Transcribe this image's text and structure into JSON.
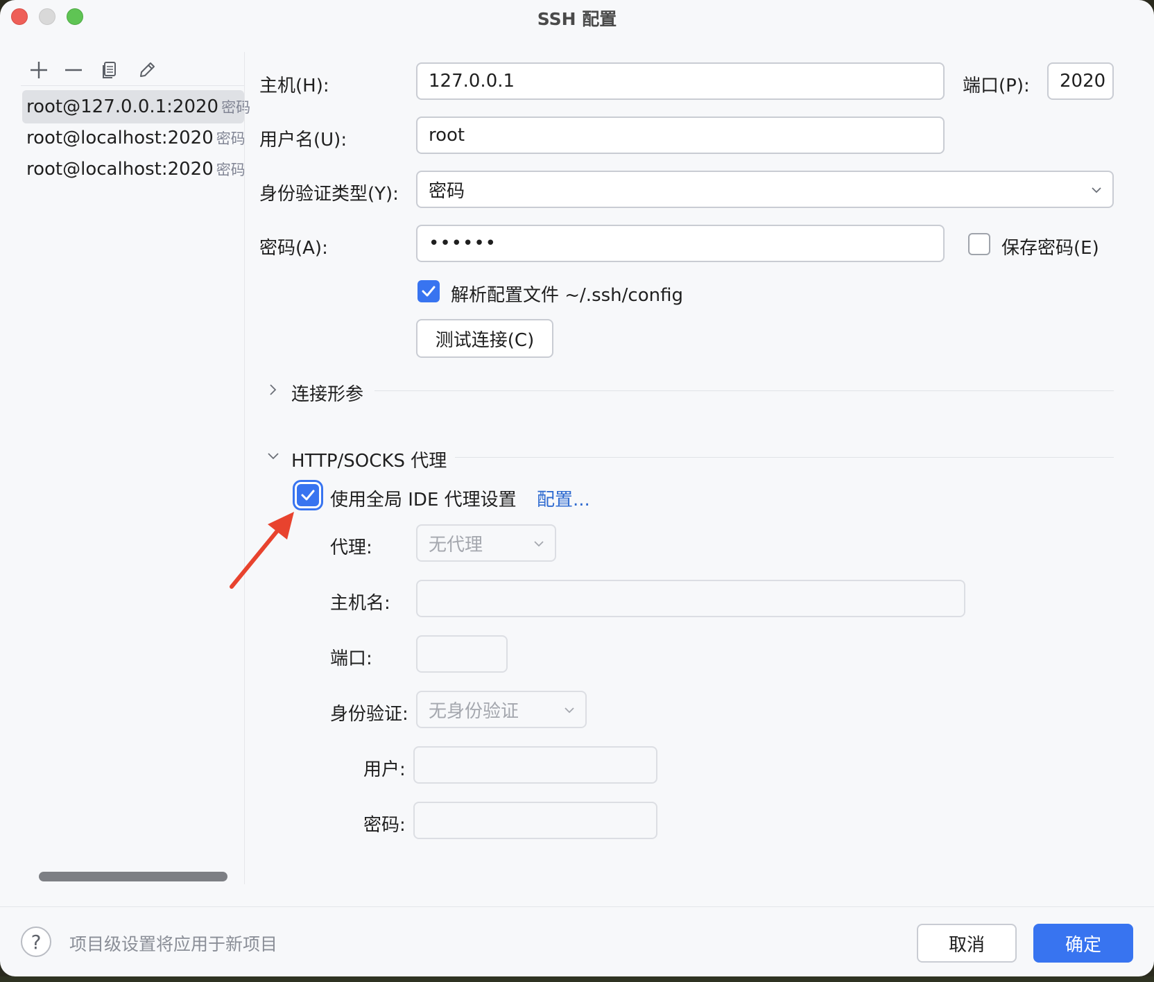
{
  "window": {
    "title": "SSH 配置"
  },
  "toolbar": {
    "add_icon": "plus-icon",
    "remove_icon": "minus-icon",
    "copy_icon": "copy-icon",
    "edit_icon": "pencil-icon"
  },
  "connections": [
    {
      "label": "root@127.0.0.1:2020",
      "tag": "密码",
      "selected": true
    },
    {
      "label": "root@localhost:2020",
      "tag": "密码",
      "selected": false
    },
    {
      "label": "root@localhost:2020",
      "tag": "密码",
      "selected": false
    }
  ],
  "form": {
    "host_label": "主机(H):",
    "host_value": "127.0.0.1",
    "port_label": "端口(P):",
    "port_value": "2020",
    "username_label": "用户名(U):",
    "username_value": "root",
    "auth_type_label": "身份验证类型(Y):",
    "auth_type_value": "密码",
    "password_label": "密码(A):",
    "password_value": "••••••",
    "save_password_label": "保存密码(E)",
    "save_password_checked": false,
    "parse_config_label": "解析配置文件 ~/.ssh/config",
    "parse_config_checked": true,
    "test_connection_label": "测试连接(C)"
  },
  "sections": {
    "connection_params": {
      "title": "连接形参",
      "expanded": false
    },
    "proxy": {
      "title": "HTTP/SOCKS 代理",
      "expanded": true
    }
  },
  "proxy": {
    "use_global_label": "使用全局 IDE 代理设置",
    "use_global_checked": true,
    "configure_link": "配置...",
    "proxy_label": "代理:",
    "proxy_value": "无代理",
    "hostname_label": "主机名:",
    "hostname_value": "",
    "port_label": "端口:",
    "port_value": "",
    "auth_label": "身份验证:",
    "auth_value": "无身份验证",
    "user_label": "用户:",
    "user_value": "",
    "password_label": "密码:",
    "password_value": ""
  },
  "footer": {
    "help_symbol": "?",
    "hint": "项目级设置将应用于新项目",
    "cancel_label": "取消",
    "ok_label": "确定"
  },
  "colors": {
    "accent": "#3874f0",
    "link": "#2e6ad0",
    "annotation_arrow": "#e8432e"
  }
}
